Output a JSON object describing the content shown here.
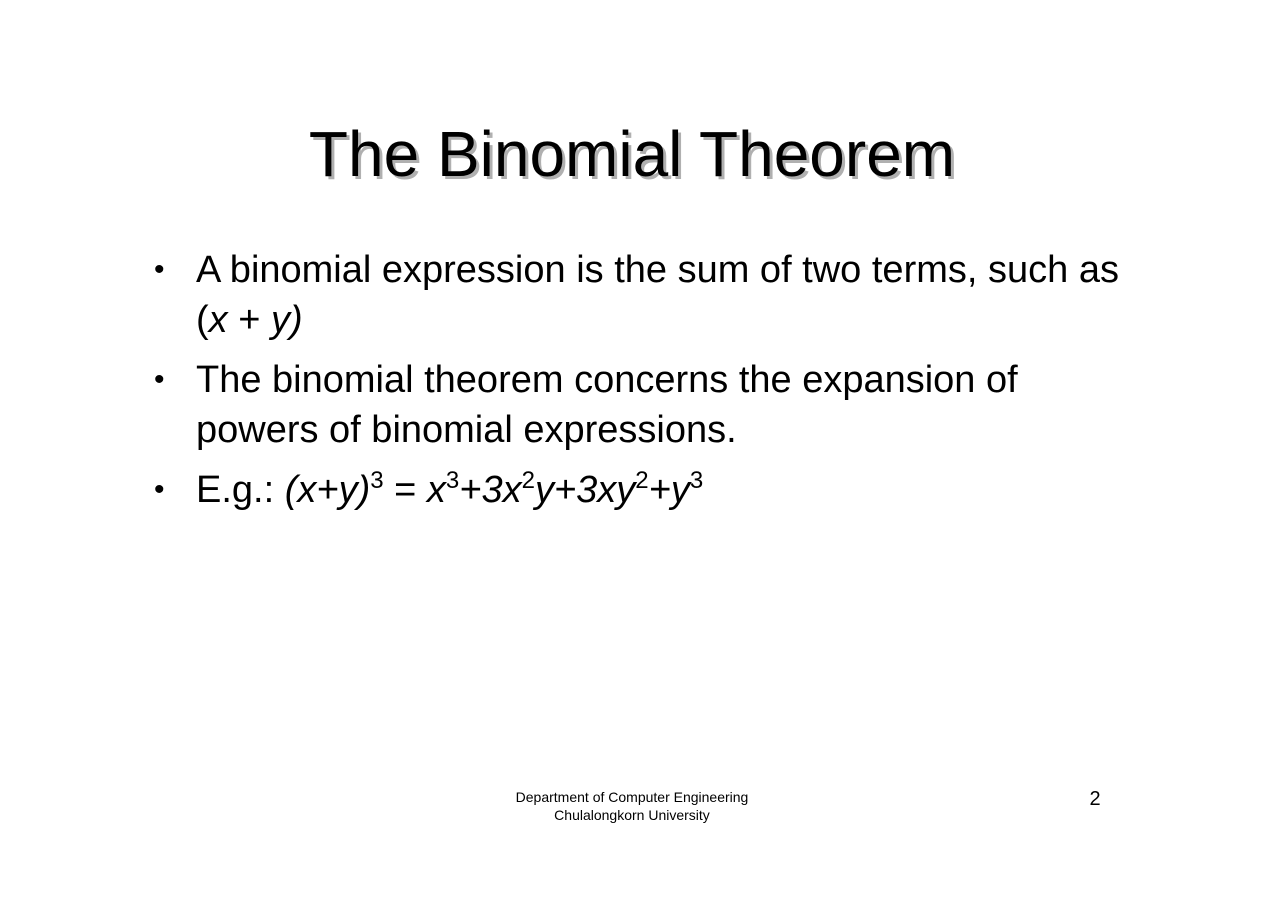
{
  "slide": {
    "title": "The Binomial Theorem",
    "bullets": [
      {
        "segments": [
          {
            "text": "A binomial expression is the sum of two terms, such as (",
            "style": "normal"
          },
          {
            "text": "x",
            "style": "italic"
          },
          {
            "text": " + ",
            "style": "normal"
          },
          {
            "text": "y)",
            "style": "italic"
          }
        ]
      },
      {
        "segments": [
          {
            "text": "The binomial theorem concerns the expansion of powers of binomial expressions.",
            "style": "normal"
          }
        ]
      },
      {
        "segments": [
          {
            "text": "E.g.: ",
            "style": "normal"
          },
          {
            "text": "(x+y)",
            "style": "italic"
          },
          {
            "text": "3",
            "style": "sup"
          },
          {
            "text": " = ",
            "style": "normal"
          },
          {
            "text": "x",
            "style": "italic"
          },
          {
            "text": "3",
            "style": "sup"
          },
          {
            "text": "+3x",
            "style": "italic"
          },
          {
            "text": "2",
            "style": "sup"
          },
          {
            "text": "y+3xy",
            "style": "italic"
          },
          {
            "text": "2",
            "style": "sup"
          },
          {
            "text": "+y",
            "style": "italic"
          },
          {
            "text": "3",
            "style": "sup"
          }
        ]
      }
    ],
    "bullet_symbol": "•"
  },
  "footer": {
    "line1": "Department of Computer Engineering",
    "line2": "Chulalongkorn University",
    "page_number": "2"
  }
}
